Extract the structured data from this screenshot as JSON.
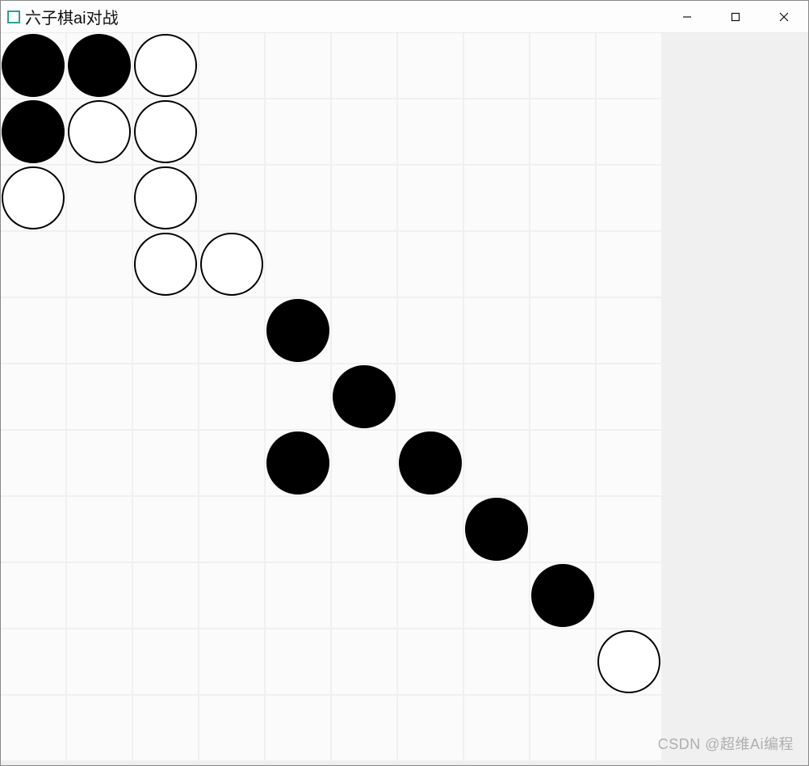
{
  "window": {
    "title": "六子棋ai对战",
    "icon": "app-icon"
  },
  "controls": {
    "minimize": "minimize",
    "maximize": "maximize",
    "close": "close"
  },
  "board": {
    "cols": 10,
    "rows": 11,
    "stones": [
      {
        "row": 0,
        "col": 0,
        "color": "black"
      },
      {
        "row": 0,
        "col": 1,
        "color": "black"
      },
      {
        "row": 0,
        "col": 2,
        "color": "white"
      },
      {
        "row": 1,
        "col": 0,
        "color": "black"
      },
      {
        "row": 1,
        "col": 1,
        "color": "white"
      },
      {
        "row": 1,
        "col": 2,
        "color": "white"
      },
      {
        "row": 2,
        "col": 0,
        "color": "white"
      },
      {
        "row": 2,
        "col": 2,
        "color": "white"
      },
      {
        "row": 3,
        "col": 2,
        "color": "white"
      },
      {
        "row": 3,
        "col": 3,
        "color": "white"
      },
      {
        "row": 4,
        "col": 4,
        "color": "black"
      },
      {
        "row": 5,
        "col": 5,
        "color": "black"
      },
      {
        "row": 6,
        "col": 4,
        "color": "black"
      },
      {
        "row": 6,
        "col": 6,
        "color": "black"
      },
      {
        "row": 7,
        "col": 7,
        "color": "black"
      },
      {
        "row": 8,
        "col": 8,
        "color": "black"
      },
      {
        "row": 9,
        "col": 9,
        "color": "white"
      }
    ]
  },
  "watermark": "CSDN @超维Ai编程"
}
